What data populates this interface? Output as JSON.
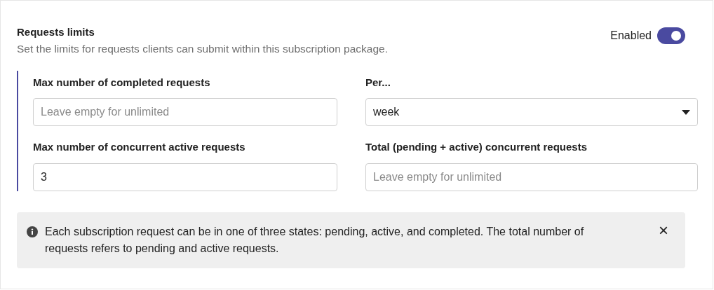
{
  "section": {
    "title": "Requests limits",
    "description": "Set the limits for requests clients can submit within this subscription package.",
    "toggle": {
      "label": "Enabled",
      "on": true
    }
  },
  "fields": [
    {
      "kind": "text",
      "label": "Max number of completed requests",
      "placeholder": "Leave empty for unlimited"
    },
    {
      "kind": "select",
      "label": "Per...",
      "value": "week"
    },
    {
      "kind": "text",
      "label": "Max number of concurrent active requests",
      "value": "3"
    },
    {
      "kind": "text",
      "label": "Total (pending + active) concurrent requests",
      "placeholder": "Leave empty for unlimited"
    }
  ],
  "alert": {
    "text": "Each subscription request can be in one of three states: pending, active, and completed. The total number of requests refers to pending and active requests.",
    "close": "×"
  }
}
